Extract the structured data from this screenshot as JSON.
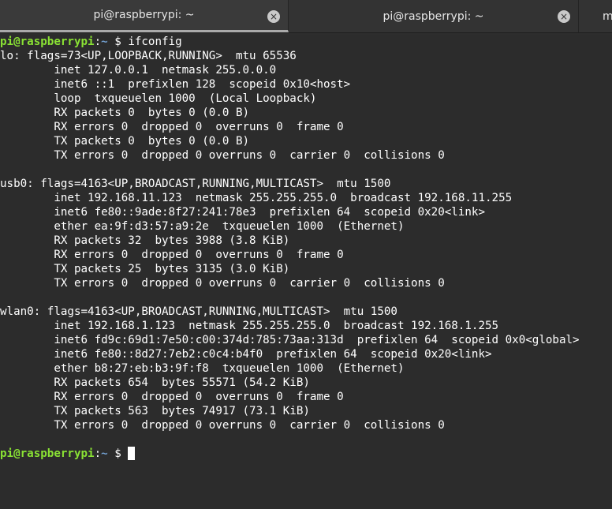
{
  "tabs": [
    {
      "title": "pi@raspberrypi: ~",
      "close": "×"
    },
    {
      "title": "pi@raspberrypi: ~",
      "close": "×"
    },
    {
      "title": "m"
    }
  ],
  "prompt": {
    "user_host": "pi@raspberrypi",
    "sep": ":",
    "path": "~",
    "symbol": " $ "
  },
  "command": "ifconfig",
  "output": [
    "lo: flags=73<UP,LOOPBACK,RUNNING>  mtu 65536",
    "        inet 127.0.0.1  netmask 255.0.0.0",
    "        inet6 ::1  prefixlen 128  scopeid 0x10<host>",
    "        loop  txqueuelen 1000  (Local Loopback)",
    "        RX packets 0  bytes 0 (0.0 B)",
    "        RX errors 0  dropped 0  overruns 0  frame 0",
    "        TX packets 0  bytes 0 (0.0 B)",
    "        TX errors 0  dropped 0 overruns 0  carrier 0  collisions 0",
    "",
    "usb0: flags=4163<UP,BROADCAST,RUNNING,MULTICAST>  mtu 1500",
    "        inet 192.168.11.123  netmask 255.255.255.0  broadcast 192.168.11.255",
    "        inet6 fe80::9ade:8f27:241:78e3  prefixlen 64  scopeid 0x20<link>",
    "        ether ea:9f:d3:57:a9:2e  txqueuelen 1000  (Ethernet)",
    "        RX packets 32  bytes 3988 (3.8 KiB)",
    "        RX errors 0  dropped 0  overruns 0  frame 0",
    "        TX packets 25  bytes 3135 (3.0 KiB)",
    "        TX errors 0  dropped 0 overruns 0  carrier 0  collisions 0",
    "",
    "wlan0: flags=4163<UP,BROADCAST,RUNNING,MULTICAST>  mtu 1500",
    "        inet 192.168.1.123  netmask 255.255.255.0  broadcast 192.168.1.255",
    "        inet6 fd9c:69d1:7e50:c00:374d:785:73aa:313d  prefixlen 64  scopeid 0x0<global>",
    "        inet6 fe80::8d27:7eb2:c0c4:b4f0  prefixlen 64  scopeid 0x20<link>",
    "        ether b8:27:eb:b3:9f:f8  txqueuelen 1000  (Ethernet)",
    "        RX packets 654  bytes 55571 (54.2 KiB)",
    "        RX errors 0  dropped 0  overruns 0  frame 0",
    "        TX packets 563  bytes 74917 (73.1 KiB)",
    "        TX errors 0  dropped 0 overruns 0  carrier 0  collisions 0",
    ""
  ],
  "colors": {
    "user_host": "#8ae234",
    "path": "#729fcf",
    "background": "#2c2c2c",
    "text": "#ffffff"
  }
}
